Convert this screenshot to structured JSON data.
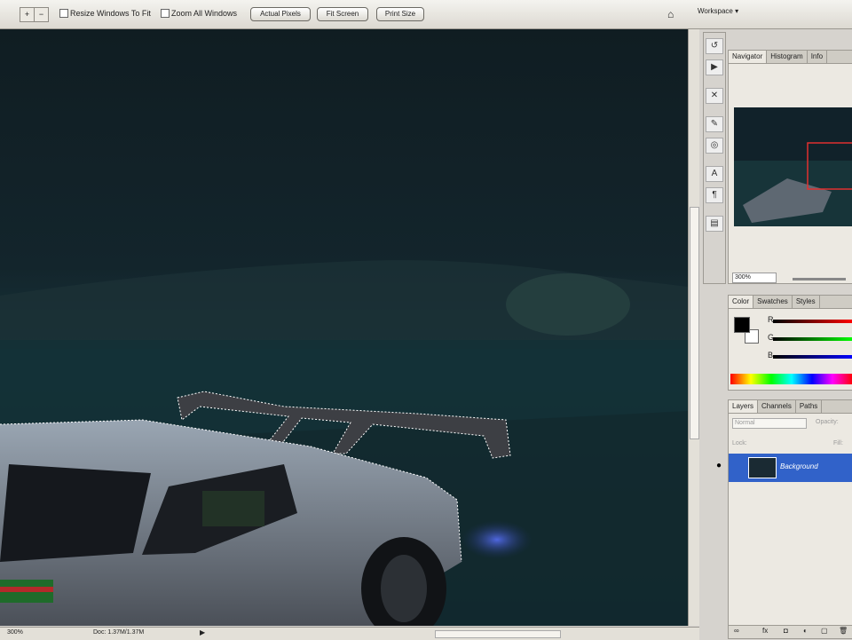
{
  "options_bar": {
    "resize_windows_label": "Resize Windows To Fit",
    "zoom_all_windows_label": "Zoom All Windows",
    "actual_pixels": "Actual Pixels",
    "fit_screen": "Fit Screen",
    "print_size": "Print Size",
    "workspace": "Workspace ▾"
  },
  "navigator_panel": {
    "tabs": [
      "Navigator",
      "Histogram",
      "Info"
    ],
    "zoom": "300%"
  },
  "color_panel": {
    "tabs": [
      "Color",
      "Swatches",
      "Styles"
    ],
    "channels": [
      "R",
      "G",
      "B"
    ],
    "colors": {
      "foreground": "#000000",
      "background": "#ffffff"
    }
  },
  "layers_panel": {
    "tabs": [
      "Layers",
      "Channels",
      "Paths"
    ],
    "blend_mode": "Normal",
    "opacity_label": "Opacity:",
    "lock_label": "Lock:",
    "fill_label": "Fill:",
    "layer_name": "Background"
  },
  "status_bar": {
    "zoom": "300%",
    "doc": "Doc: 1.37M/1.37M"
  }
}
